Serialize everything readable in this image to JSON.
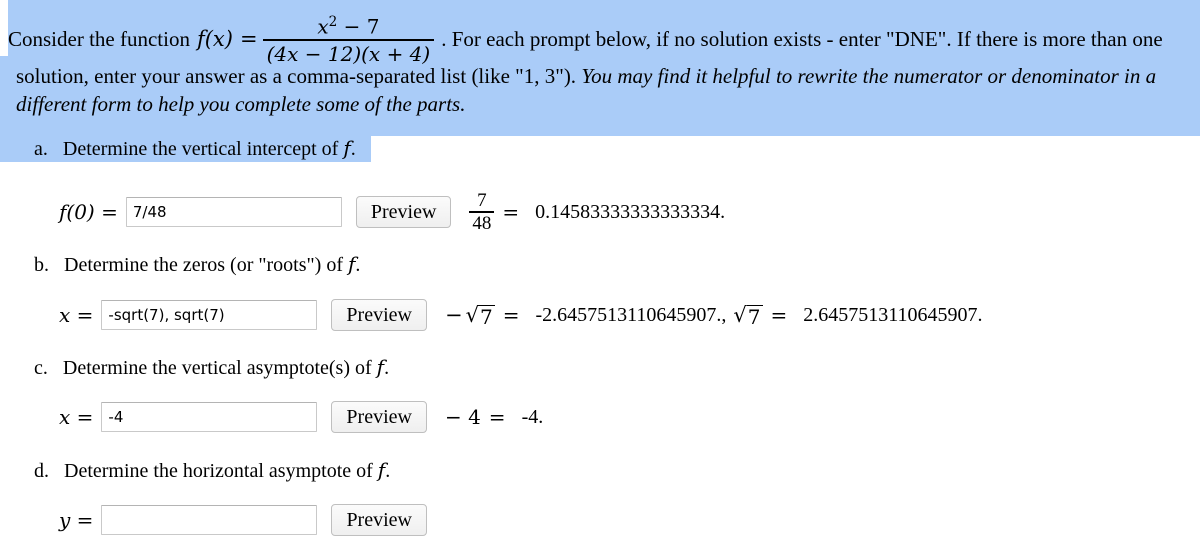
{
  "intro": {
    "lead": "Consider the function",
    "function_name": "f(x)",
    "equals": "=",
    "numerator": "x² − 7",
    "numerator_base": "x",
    "numerator_exp": "2",
    "numerator_rest": "− 7",
    "denominator": "(4x − 12)(x + 4)",
    "after_fraction": ". For each prompt below, if no solution exists - enter \"DNE\". If there is more than one",
    "line2_plain": "solution, enter your answer as a comma-separated list (like \"1, 3\").",
    "line2_italic": " You may find it helpful to rewrite the numerator or denominator in a different form to help you complete some of the parts."
  },
  "parts": [
    {
      "marker": "a.",
      "prompt": "Determine the vertical intercept of",
      "prompt_var": "f",
      "prompt_end": ".",
      "lhs_var": "f(0)",
      "lhs_eq": "=",
      "value": "7/48",
      "placeholder": "",
      "preview_label": "Preview",
      "result_kind": "fraction",
      "result_num": "7",
      "result_den": "48",
      "result_eq": "=",
      "result_value": "0.14583333333333334."
    },
    {
      "marker": "b.",
      "prompt": "Determine the zeros (or \"roots\") of",
      "prompt_var": "f",
      "prompt_end": ".",
      "lhs_var": "x",
      "lhs_eq": "=",
      "value": "-sqrt(7), sqrt(7)",
      "placeholder": "",
      "preview_label": "Preview",
      "result_kind": "radicals",
      "result_minus": "−",
      "result_radicand": "7",
      "result_eq": "=",
      "result_value": "-2.6457513110645907.",
      "result_sep": ",",
      "result_radicand2": "7",
      "result_eq2": "=",
      "result_value2": "2.6457513110645907."
    },
    {
      "marker": "c.",
      "prompt": "Determine the vertical asymptote(s) of",
      "prompt_var": "f",
      "prompt_end": ".",
      "lhs_var": "x",
      "lhs_eq": "=",
      "value": "-4",
      "placeholder": "",
      "preview_label": "Preview",
      "result_kind": "simple",
      "result_expr": "− 4",
      "result_eq": "=",
      "result_value": "-4."
    },
    {
      "marker": "d.",
      "prompt": "Determine the horizontal asymptote of",
      "prompt_var": "f",
      "prompt_end": ".",
      "lhs_var": "y",
      "lhs_eq": "=",
      "value": "",
      "placeholder": "",
      "preview_label": "Preview",
      "result_kind": "none"
    }
  ],
  "colors": {
    "selection_highlight": "#aaccf8",
    "page_background": "#ffffff",
    "text": "#000000",
    "input_border": "#c9c9c9"
  }
}
